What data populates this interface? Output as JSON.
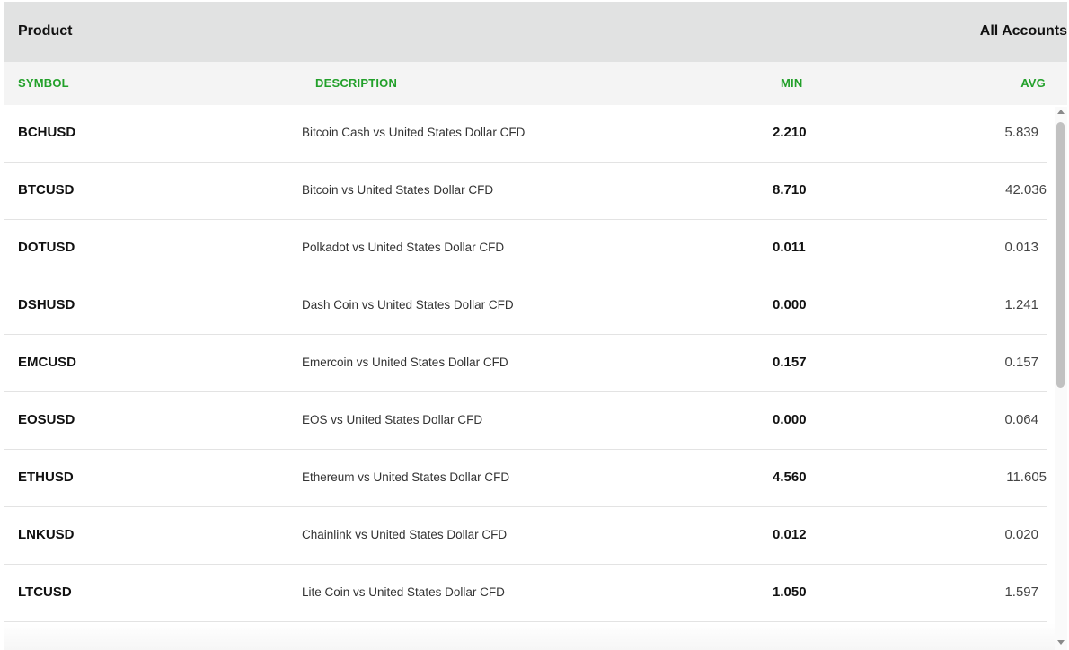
{
  "header": {
    "left_label": "Product",
    "right_label": "All Accounts"
  },
  "columns": {
    "symbol": "SYMBOL",
    "description": "DESCRIPTION",
    "min": "MIN",
    "avg": "AVG"
  },
  "rows": [
    {
      "symbol": "BCHUSD",
      "description": "Bitcoin Cash vs United States Dollar CFD",
      "min": "2.210",
      "avg": "5.839"
    },
    {
      "symbol": "BTCUSD",
      "description": "Bitcoin vs United States Dollar CFD",
      "min": "8.710",
      "avg": "42.036"
    },
    {
      "symbol": "DOTUSD",
      "description": "Polkadot vs United States Dollar CFD",
      "min": "0.011",
      "avg": "0.013"
    },
    {
      "symbol": "DSHUSD",
      "description": "Dash Coin vs United States Dollar CFD",
      "min": "0.000",
      "avg": "1.241"
    },
    {
      "symbol": "EMCUSD",
      "description": "Emercoin vs United States Dollar CFD",
      "min": "0.157",
      "avg": "0.157"
    },
    {
      "symbol": "EOSUSD",
      "description": "EOS vs United States Dollar CFD",
      "min": "0.000",
      "avg": "0.064"
    },
    {
      "symbol": "ETHUSD",
      "description": "Ethereum vs United States Dollar CFD",
      "min": "4.560",
      "avg": "11.605"
    },
    {
      "symbol": "LNKUSD",
      "description": "Chainlink vs United States Dollar CFD",
      "min": "0.012",
      "avg": "0.020"
    },
    {
      "symbol": "LTCUSD",
      "description": "Lite Coin vs United States Dollar CFD",
      "min": "1.050",
      "avg": "1.597"
    }
  ],
  "colors": {
    "column_header_text": "#22a02a",
    "top_header_bg": "#e1e2e2",
    "column_header_bg": "#f4f4f4"
  }
}
